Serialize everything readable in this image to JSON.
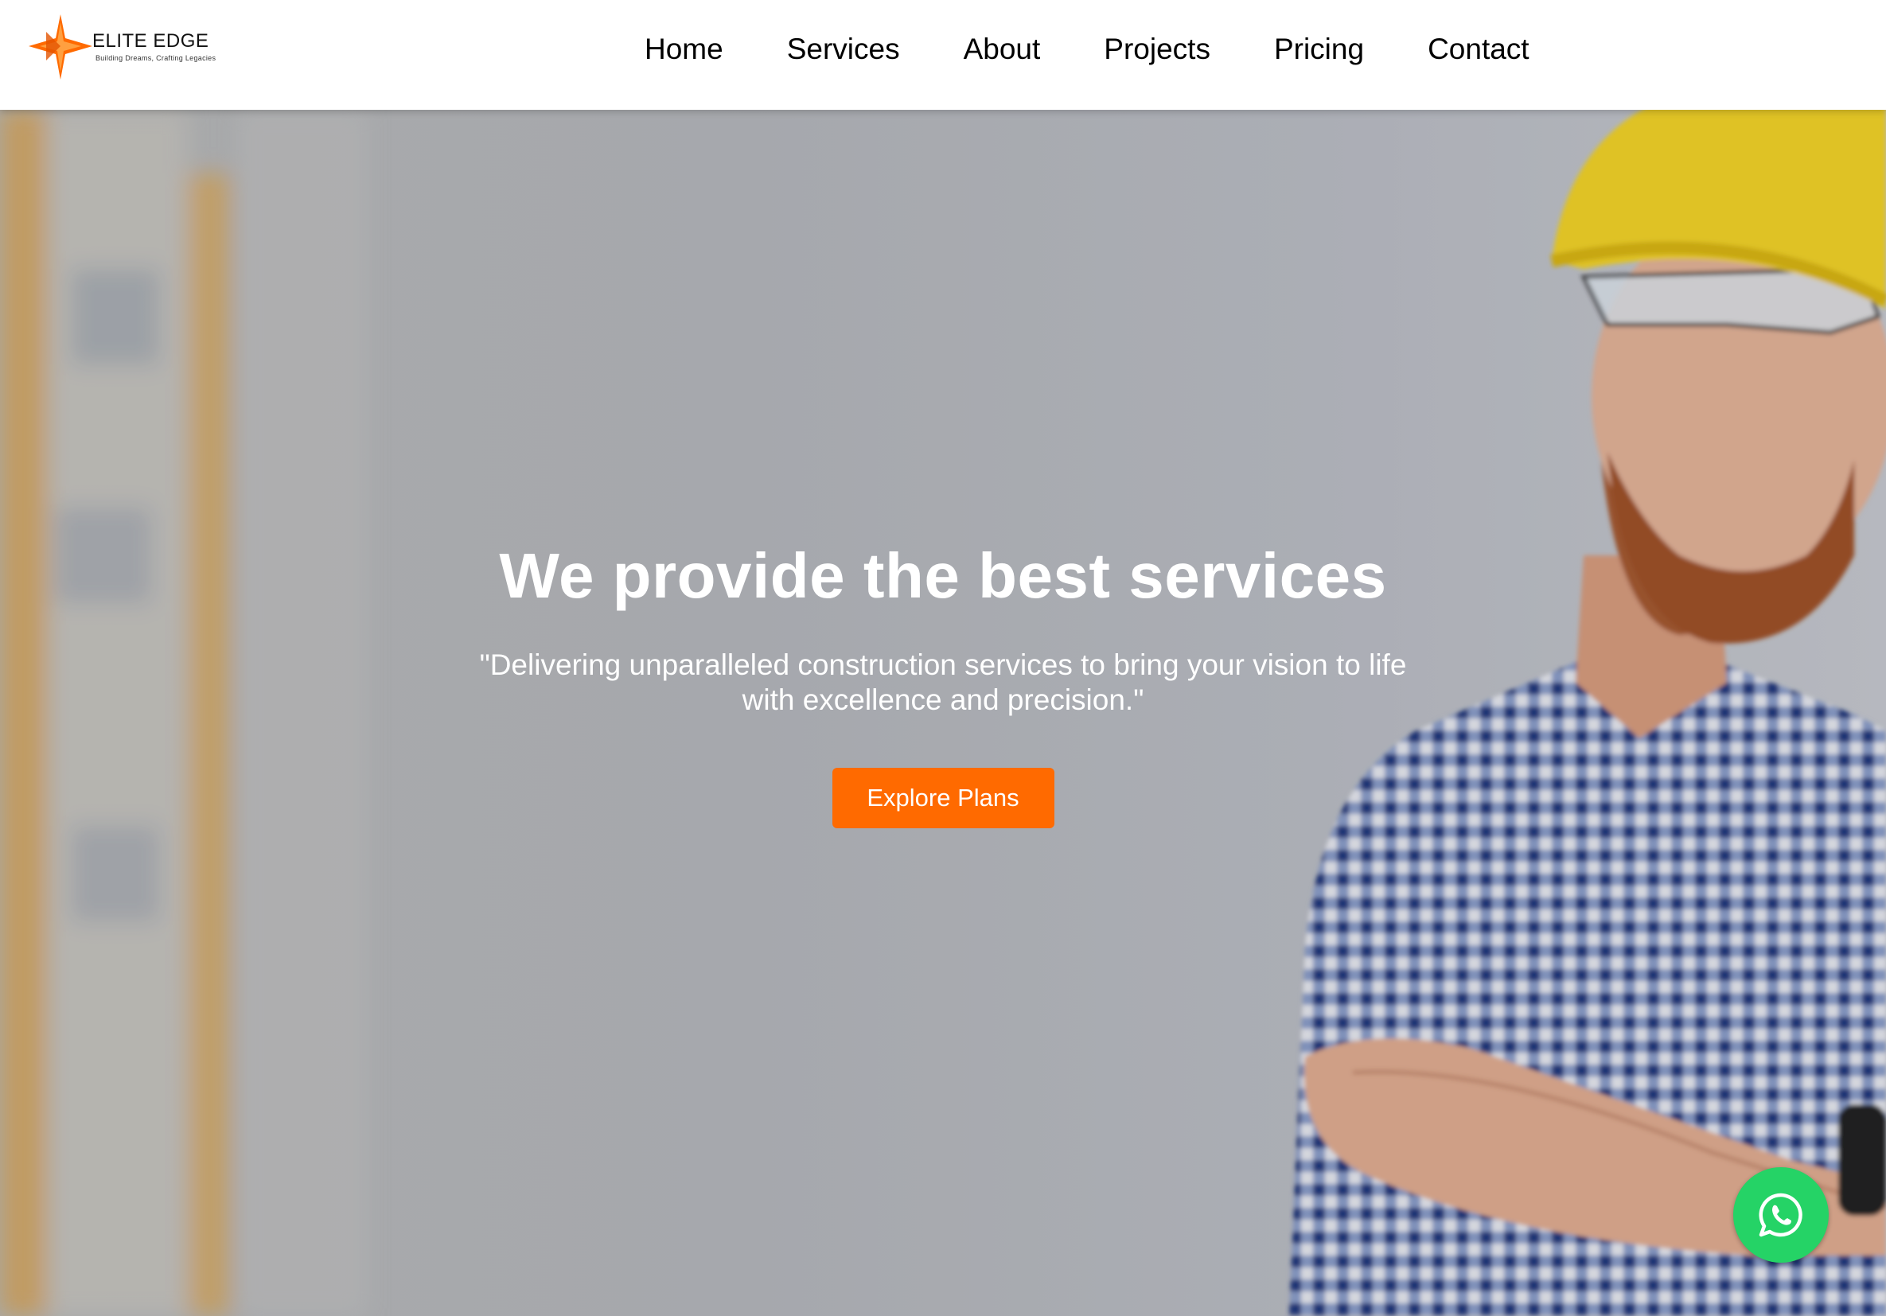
{
  "header": {
    "logo": {
      "name": "ELITE EDGE",
      "tagline": "Building Dreams, Crafting Legacies"
    },
    "nav": [
      {
        "label": "Home"
      },
      {
        "label": "Services"
      },
      {
        "label": "About"
      },
      {
        "label": "Projects"
      },
      {
        "label": "Pricing"
      },
      {
        "label": "Contact"
      }
    ]
  },
  "hero": {
    "title": "We provide the best services",
    "subtitle": "\"Delivering unparalleled construction services to bring your vision to life with excellence and precision.\"",
    "cta_label": "Explore Plans"
  },
  "colors": {
    "accent": "#ff6a00",
    "whatsapp": "#25d366",
    "helmet": "#f2d223",
    "shirt_check": "#1f3f8a"
  },
  "icons": {
    "logo": "star-burst-logo-icon",
    "whatsapp": "whatsapp-icon"
  }
}
